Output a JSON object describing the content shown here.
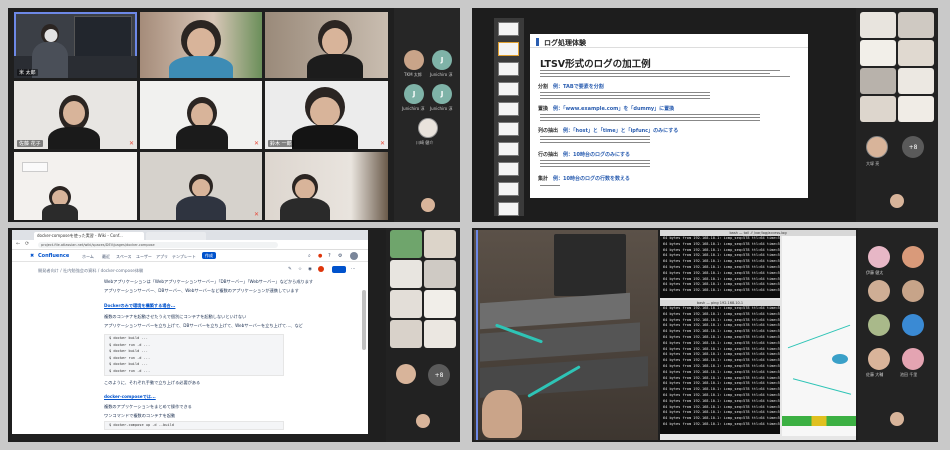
{
  "quad1": {
    "tiles": [
      {
        "name": "米 太郎",
        "muted": false
      },
      {
        "name": "",
        "muted": false
      },
      {
        "name": "",
        "muted": false
      },
      {
        "name": "佐藤 花子",
        "muted": true
      },
      {
        "name": "",
        "muted": true
      },
      {
        "name": "鈴木 一郎",
        "muted": true
      },
      {
        "name": "",
        "muted": false
      },
      {
        "name": "",
        "muted": true
      },
      {
        "name": "",
        "muted": false
      }
    ],
    "participants": [
      {
        "initial": "",
        "name": "TKM 太郎"
      },
      {
        "initial": "J",
        "name": "Junichiro 淳"
      },
      {
        "initial": "J",
        "name": "Junichiro 淳"
      },
      {
        "initial": "J",
        "name": "Junichiro 淳"
      },
      {
        "initial": "",
        "name": "川崎 健介"
      }
    ]
  },
  "quad2": {
    "slide_title": "ログ処理体験",
    "slide_heading": "LTSV形式のログの加工例",
    "sections": [
      {
        "label": "分割",
        "detail": "例：TABで要素を分割"
      },
      {
        "label": "置換",
        "detail": "例：「www.example.com」を「dummy」に置換"
      },
      {
        "label": "列の抽出",
        "detail": "例：「host」と「time」と「ipfunc」のみにする"
      },
      {
        "label": "行の抽出",
        "detail": "例：10時台のログのみにする"
      },
      {
        "label": "集計",
        "detail": "例：10時台のログの行数を数える"
      }
    ],
    "more_count": "+8",
    "side_names": [
      "",
      "",
      "",
      "",
      "",
      "",
      "",
      "",
      "大塚 亮"
    ]
  },
  "quad3": {
    "tab_title": "docker-composeを使った実習 - Wiki - Conf...",
    "url": "project-file.atlassian.net/wiki/spaces/DEV/pages/docker-compose",
    "logo": "Confluence",
    "menu": [
      "ホーム",
      "最近",
      "スペース",
      "ユーザー",
      "アプリ",
      "テンプレート"
    ],
    "create": "作成",
    "breadcrumb": "開発者向け / 社内勉強会の資料 / docker-compose体験",
    "para1": "Webアプリケーションは「Webアプリケーションサーバー」「DBサーバー」「Webサーバー」などから成ります",
    "para2": "アプリケーションサーバー、DBサーバー、Webサーバーなど複数のアプリケーションが連携しています",
    "link1": "Dockerのみで環境を構築する場合...",
    "para3": "複数のコンテナを起動させたうえで個別にコンテナを起動しないといけない",
    "para4": "アプリケーションサーバーを立ち上げて、DBサーバーを立ち上げて、Webサーバーを立ち上げて…、など",
    "code1": [
      "$ docker build ...",
      "$ docker run -d ...",
      "$ docker build ...",
      "$ docker run -d ...",
      "$ docker build ...",
      "$ docker run -d ..."
    ],
    "para5": "このように、それぞれ手動で立ち上げる必要がある",
    "link2": "docker-composeでは...",
    "para6": "複数のアプリケーションをまとめて操作できる",
    "para7": "ワンコマンドで複数のコンテナを起動",
    "code2": [
      "$ docker-compose up -d --build"
    ],
    "more_count": "+8"
  },
  "quad4": {
    "term_title": "bash — tail -f /var/log/access.log",
    "term2_title": "bash — ping 192.168.10.1",
    "log_line": "64 bytes from 192.168.10.1: icmp_seq=578 ttl=64 time=5.432 ms",
    "side_names": [
      "伊藤 健太",
      "",
      "",
      "",
      "",
      "",
      "佐藤 大輔",
      "池田 千里"
    ]
  },
  "colors": {
    "active_border": "#6d88e6",
    "confluence_blue": "#0052cc",
    "muted_mic": "#e74c3c"
  }
}
